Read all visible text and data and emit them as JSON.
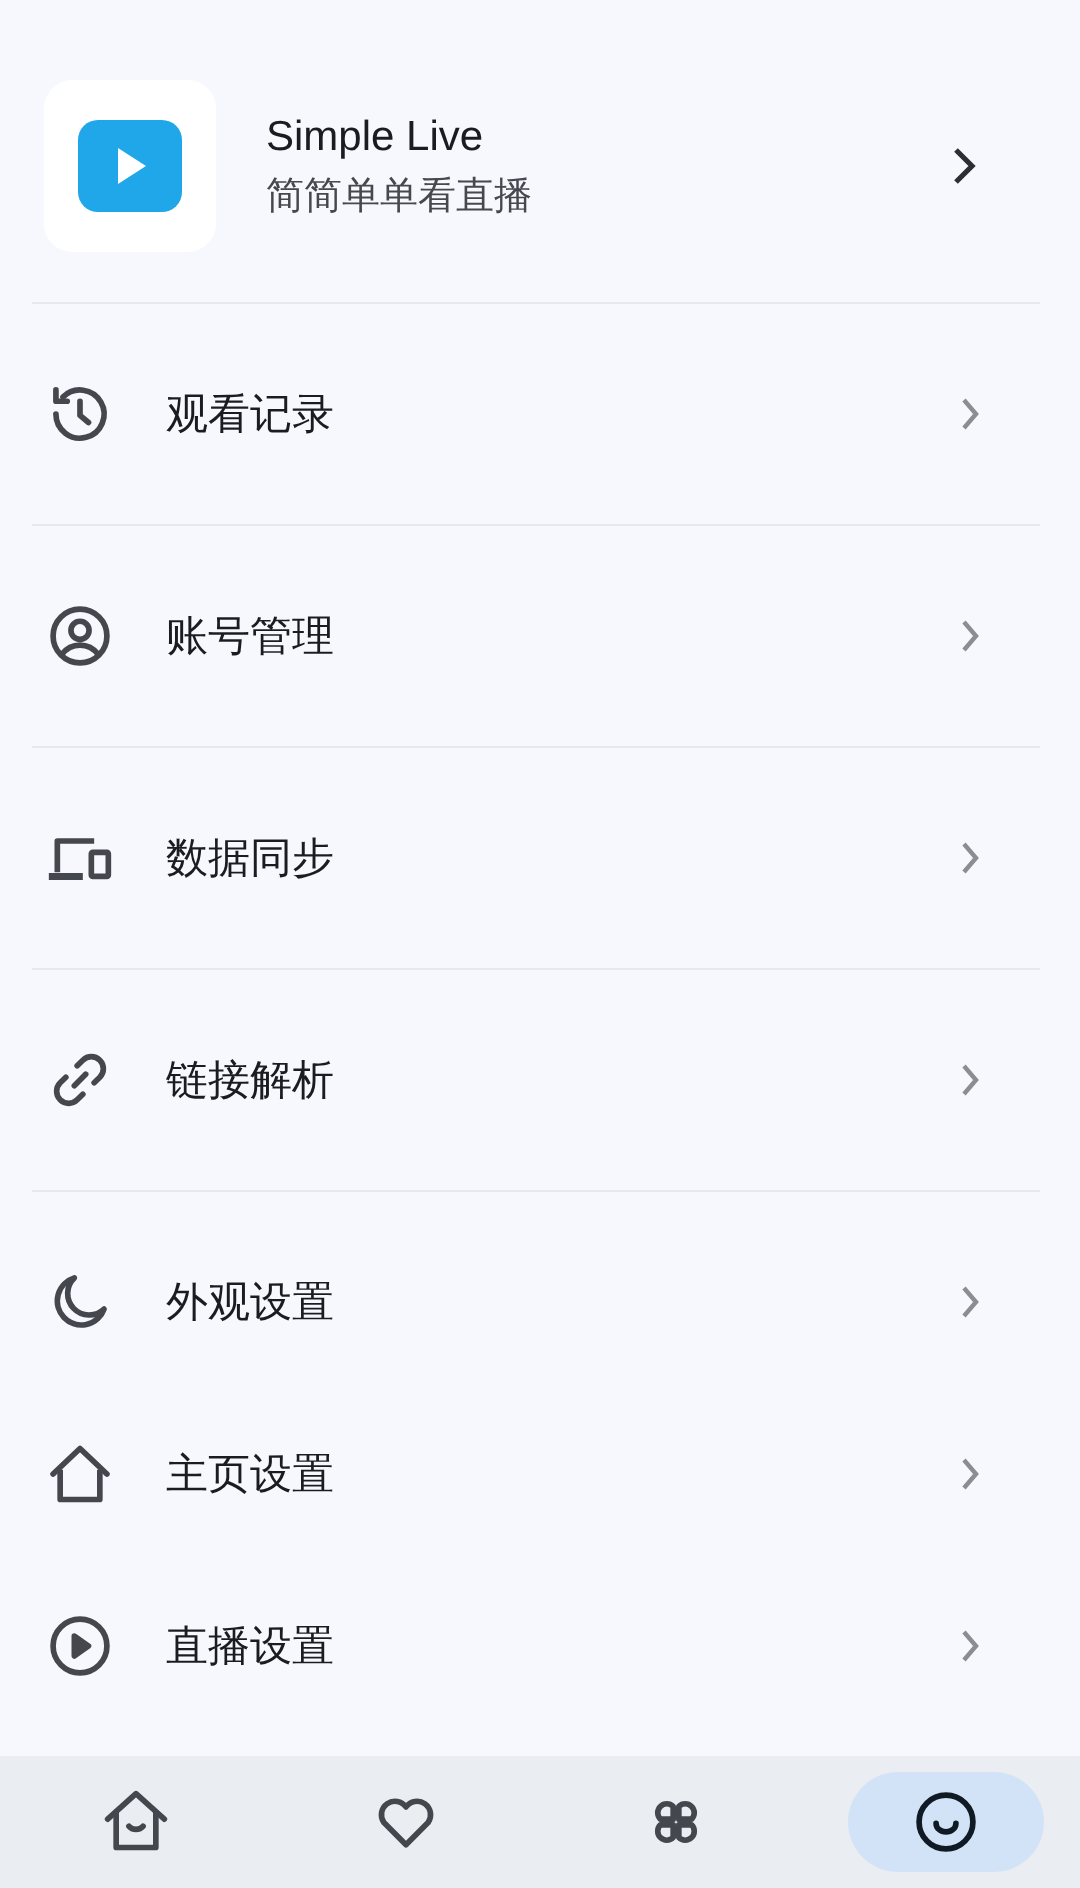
{
  "header": {
    "title": "Simple Live",
    "subtitle": "简简单单看直播"
  },
  "groups": [
    {
      "items": [
        {
          "label": "观看记录"
        }
      ]
    },
    {
      "items": [
        {
          "label": "账号管理"
        }
      ]
    },
    {
      "items": [
        {
          "label": "数据同步"
        }
      ]
    },
    {
      "items": [
        {
          "label": "链接解析"
        }
      ]
    },
    {
      "items": [
        {
          "label": "外观设置"
        },
        {
          "label": "主页设置"
        },
        {
          "label": "直播设置"
        }
      ]
    }
  ],
  "nav": [
    {
      "selected": false
    },
    {
      "selected": false
    },
    {
      "selected": false
    },
    {
      "selected": true
    }
  ]
}
